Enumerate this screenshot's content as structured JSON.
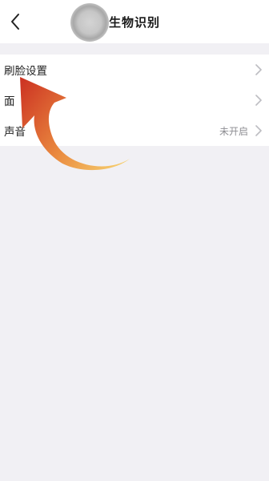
{
  "header": {
    "title": "生物识别",
    "back_icon": "chevron-left-icon"
  },
  "settings": {
    "items": [
      {
        "label": "刷脸设置",
        "value": ""
      },
      {
        "label": "面",
        "value": ""
      },
      {
        "label": "声音",
        "value": "未开启"
      }
    ]
  },
  "colors": {
    "page_background": "#f1f0f4",
    "card_background": "#ffffff",
    "arrow_start": "#f2c766",
    "arrow_end": "#cf3a24",
    "value_text": "#8e8e93",
    "chevron": "#bdbdc2"
  }
}
